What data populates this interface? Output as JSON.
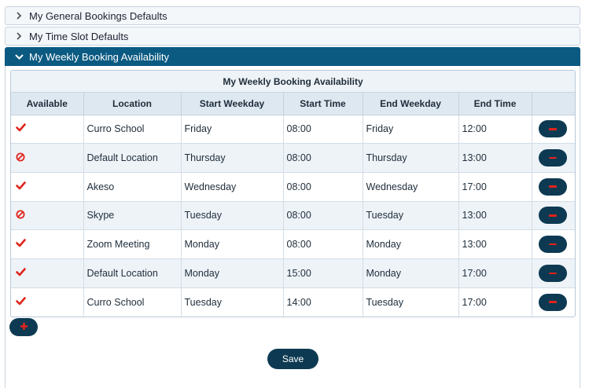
{
  "accordion": {
    "general": {
      "label": "My General Bookings Defaults"
    },
    "timeslot": {
      "label": "My Time Slot Defaults"
    },
    "weekly": {
      "label": "My Weekly Booking Availability"
    }
  },
  "grid": {
    "title": "My Weekly Booking Availability",
    "columns": [
      "Available",
      "Location",
      "Start Weekday",
      "Start Time",
      "End Weekday",
      "End Time",
      ""
    ],
    "rows": [
      {
        "available": "check-icon",
        "location": "Curro School",
        "start_weekday": "Friday",
        "start_time": "08:00",
        "end_weekday": "Friday",
        "end_time": "12:00"
      },
      {
        "available": "ban-icon",
        "location": "Default Location",
        "start_weekday": "Thursday",
        "start_time": "08:00",
        "end_weekday": "Thursday",
        "end_time": "13:00"
      },
      {
        "available": "check-icon",
        "location": "Akeso",
        "start_weekday": "Wednesday",
        "start_time": "08:00",
        "end_weekday": "Wednesday",
        "end_time": "17:00"
      },
      {
        "available": "ban-icon",
        "location": "Skype",
        "start_weekday": "Tuesday",
        "start_time": "08:00",
        "end_weekday": "Tuesday",
        "end_time": "13:00"
      },
      {
        "available": "check-icon",
        "location": "Zoom Meeting",
        "start_weekday": "Monday",
        "start_time": "08:00",
        "end_weekday": "Monday",
        "end_time": "13:00"
      },
      {
        "available": "check-icon",
        "location": "Default Location",
        "start_weekday": "Monday",
        "start_time": "15:00",
        "end_weekday": "Monday",
        "end_time": "17:00"
      },
      {
        "available": "check-icon",
        "location": "Curro School",
        "start_weekday": "Tuesday",
        "start_time": "14:00",
        "end_weekday": "Tuesday",
        "end_time": "17:00"
      }
    ]
  },
  "actions": {
    "remove_icon": "minus-icon",
    "add_icon": "plus-icon",
    "save_label": "Save"
  },
  "colors": {
    "header_active": "#0b5a82",
    "button_dark": "#0d3a52",
    "icon_red": "#e0241b"
  }
}
